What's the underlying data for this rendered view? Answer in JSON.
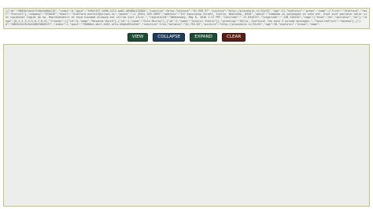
{
  "json_input": {
    "value": "[{\"id\":\"6862b7dca1f1e8a1e86e219\",\"index\":0,\"guid\":\"7e9b1257-2d98-4213-aa81-a6588a123804\",\"isActive\":false,\"balance\":\"$1,958.97\",\"picture\":\"http://placehold.it/32x32\",\"age\":21,\"eyeColor\":\"green\",\"name\":{\"first\":\"Stafford\",\"last\":\"Everett\"},\"company\":\"ECRAZE\",\"email\":\"stafford.everett@ecraze.us\",\"phone\":\"+1 (816) 429-3093\",\"address\":\"157 Kosciusko Street, Tuttle, Nebraska, 8926\",\"about\":\"Commodo in consequat ex aute est. Esse sunt pariatur dolor sint cupidatat fugiat do ea. Reprehenderit et enim eiusmod aliquip est cillum sint irure.\",\"registered\":\"Wednesday, May 8, 2016 1:17 PM\",\"latitude\":\"-72.634475\",\"longitude\":\"-138.118234\",\"tags\":[\"esse\",\"ea\",\"pariatur\",\"eu\"],\"range\":[0,1,2,3,4,5,6,7,8,9],\"friends\":[{\"id\":0,\"name\":\"Rosanne Burch\"},{\"id\":1,\"name\":\"Etta Mccray\"},{\"id\":2,\"name\":\"Schultz Steele\"}],\"greeting\":\"Hello, Stafford! You have 9 unread messages.\",\"favoriteFruit\":\"banana\"},{\"id\":\"6862b7dc9c5e4480f00b94ff\",\"index\":1,\"guid\":\"f9680b4-ebcf-4e61-af1a-d3ddc651e3e0\",\"isActive\":true,\"balance\":\"$2,753.65\",\"picture\":\"http://placehold.it/32x32\",\"age\":36,\"eyeColor\":\"brown\",\"name\":"
  },
  "toolbar": {
    "view_label": "VIEW",
    "collapse_label": "COLLAPSE",
    "expand_label": "EXPAND",
    "clear_label": "CLEAR"
  },
  "colors": {
    "view": "#1e4d35",
    "collapse": "#1f3d5a",
    "expand": "#1e4d35",
    "clear": "#5a1f14",
    "panel_border": "#c8c37a"
  }
}
